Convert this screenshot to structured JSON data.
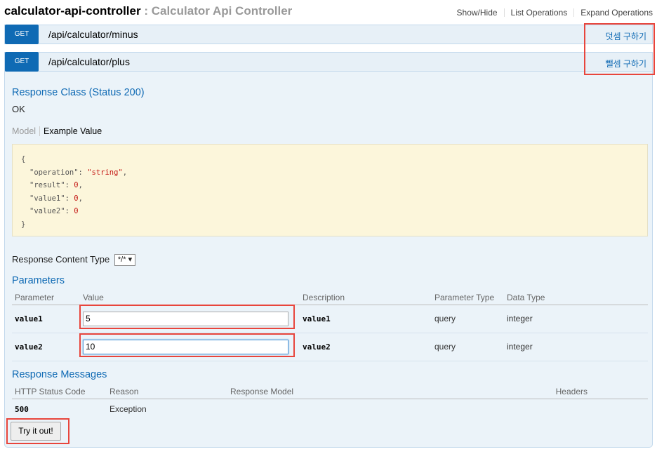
{
  "header": {
    "resource_name": "calculator-api-controller",
    "separator": " : ",
    "resource_description": "Calculator Api Controller",
    "links": [
      "Show/Hide",
      "List Operations",
      "Expand Operations"
    ]
  },
  "operations": [
    {
      "method": "GET",
      "path": "/api/calculator/minus",
      "summary": "덧셈 구하기"
    },
    {
      "method": "GET",
      "path": "/api/calculator/plus",
      "summary": "뺄셈 구하기"
    }
  ],
  "response_class": {
    "title": "Response Class (Status 200)",
    "status_text": "OK",
    "tab_model": "Model",
    "tab_example": "Example Value",
    "example": {
      "open": "{",
      "close": "}",
      "fields": [
        {
          "key": "\"operation\"",
          "value": "\"string\"",
          "comma": ","
        },
        {
          "key": "\"result\"",
          "value": "0",
          "comma": ","
        },
        {
          "key": "\"value1\"",
          "value": "0",
          "comma": ","
        },
        {
          "key": "\"value2\"",
          "value": "0",
          "comma": ""
        }
      ]
    }
  },
  "content_type": {
    "label": "Response Content Type",
    "selected": "*/*"
  },
  "parameters": {
    "title": "Parameters",
    "columns": [
      "Parameter",
      "Value",
      "Description",
      "Parameter Type",
      "Data Type"
    ],
    "rows": [
      {
        "name": "value1",
        "value": "5",
        "description": "value1",
        "param_type": "query",
        "data_type": "integer"
      },
      {
        "name": "value2",
        "value": "10",
        "description": "value2",
        "param_type": "query",
        "data_type": "integer"
      }
    ]
  },
  "response_messages": {
    "title": "Response Messages",
    "columns": [
      "HTTP Status Code",
      "Reason",
      "Response Model",
      "Headers"
    ],
    "rows": [
      {
        "code": "500",
        "reason": "Exception",
        "model": "",
        "headers": ""
      }
    ]
  },
  "try_button": "Try it out!",
  "colors": {
    "accent": "#0f6ab4",
    "highlight": "#e8453c",
    "code_bg": "#fcf6db"
  }
}
